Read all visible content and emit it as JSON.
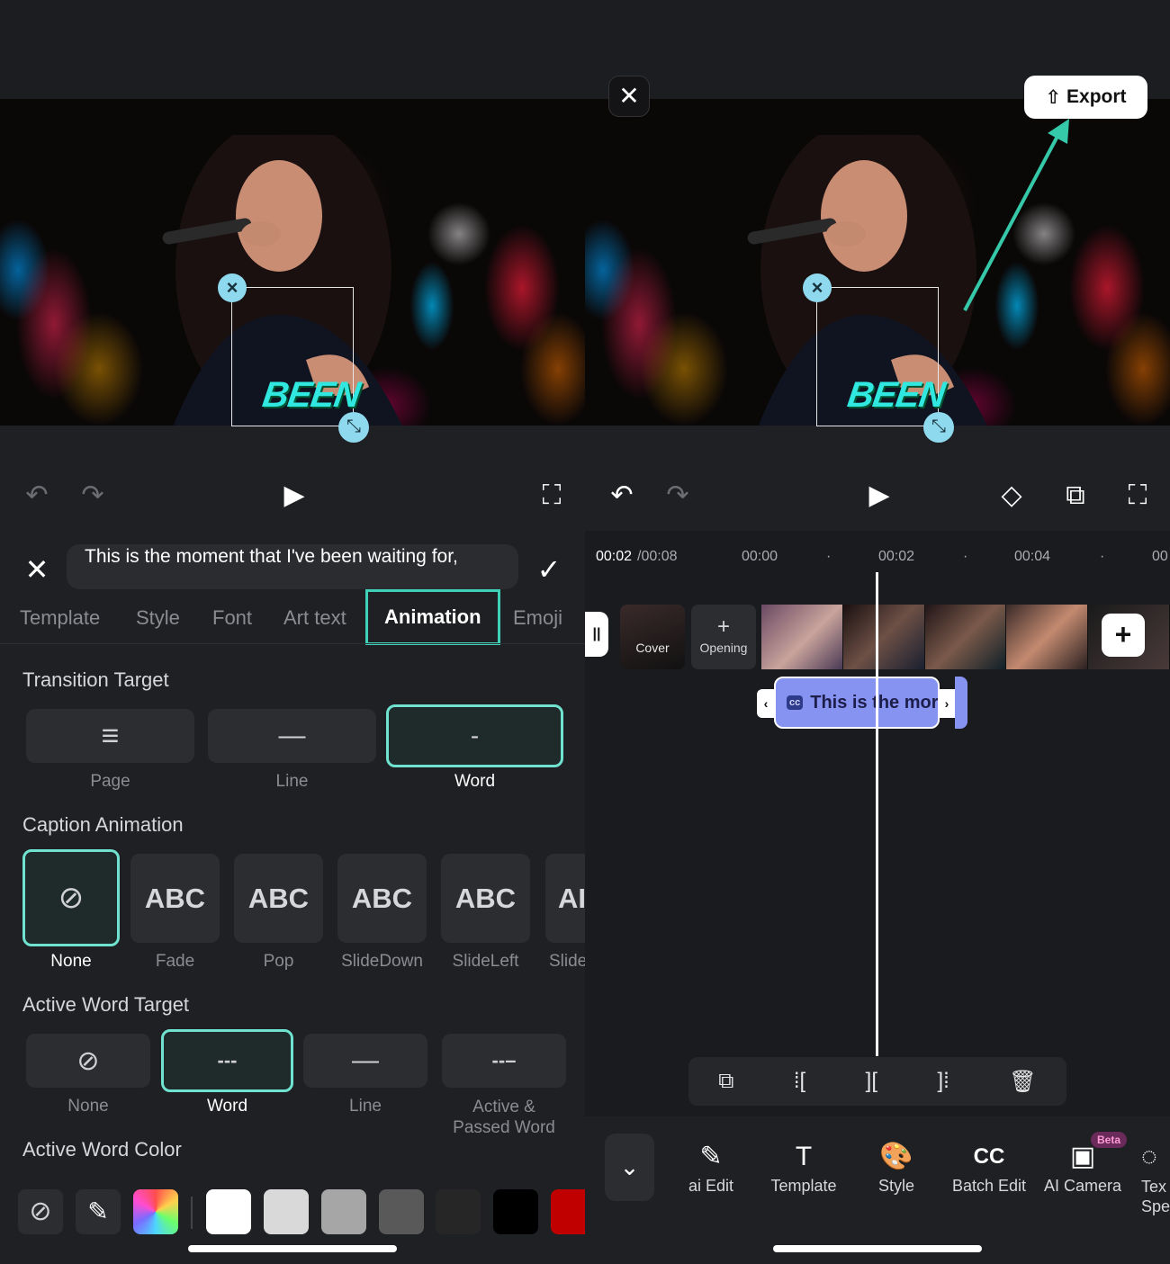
{
  "left": {
    "controls": {
      "undo": "↶",
      "redo": "↷",
      "play": "▶",
      "fullscreen": "⛶"
    },
    "overlay_text": "BEEN",
    "caption_input": "This is the moment that I've been waiting for,",
    "tabs": [
      "Template",
      "Style",
      "Font",
      "Art text",
      "Animation",
      "Emoji"
    ],
    "active_tab": "Animation",
    "transition_target": {
      "title": "Transition Target",
      "options": [
        {
          "label": "Page",
          "icon": "≡"
        },
        {
          "label": "Line",
          "icon": "—"
        },
        {
          "label": "Word",
          "icon": "-"
        }
      ],
      "selected": "Word"
    },
    "caption_animation": {
      "title": "Caption Animation",
      "options": [
        {
          "label": "None",
          "text": "⊘"
        },
        {
          "label": "Fade",
          "text": "ABC"
        },
        {
          "label": "Pop",
          "text": "ABC"
        },
        {
          "label": "SlideDown",
          "text": "ABC"
        },
        {
          "label": "SlideLeft",
          "text": "ABC"
        },
        {
          "label": "Slide",
          "text": "AI"
        }
      ],
      "selected": "None"
    },
    "active_word_target": {
      "title": "Active Word Target",
      "options": [
        {
          "label": "None",
          "icon": "⊘"
        },
        {
          "label": "Word",
          "icon": "---"
        },
        {
          "label": "Line",
          "icon": "—"
        },
        {
          "label": "Active & Passed Word",
          "icon": "--–"
        }
      ],
      "selected": "Word"
    },
    "active_word_color": {
      "title": "Active Word Color",
      "swatches": [
        "#ffffff",
        "#d9d9d9",
        "#a6a6a6",
        "#595959",
        "#262626",
        "#000000",
        "#c00000"
      ]
    }
  },
  "right": {
    "close_label": "✕",
    "export_label": "Export",
    "controls": {
      "undo": "↶",
      "redo": "↷",
      "play": "▶",
      "keyframe": "◇",
      "pip": "⧉",
      "fullscreen": "⛶"
    },
    "overlay_text": "BEEN",
    "time_current": "00:02",
    "time_total": "/00:08",
    "ruler": [
      "00:00",
      "·",
      "00:02",
      "·",
      "00:04",
      "·",
      "00"
    ],
    "cover_label": "Cover",
    "opening_label": "Opening",
    "caption_clip_text": "This is the mor",
    "cc_badge": "cc",
    "edit_tools": [
      "copy",
      "split-left",
      "split",
      "split-right",
      "delete"
    ],
    "bottom_tools": [
      {
        "label": "ai Edit",
        "icon": "✎"
      },
      {
        "label": "Template",
        "icon": "T"
      },
      {
        "label": "Style",
        "icon": "🎨"
      },
      {
        "label": "Batch Edit",
        "icon": "CC"
      },
      {
        "label": "AI Camera",
        "icon": "▣"
      },
      {
        "label": "Tex Spe",
        "icon": "◌"
      }
    ],
    "beta_badge": "Beta"
  }
}
